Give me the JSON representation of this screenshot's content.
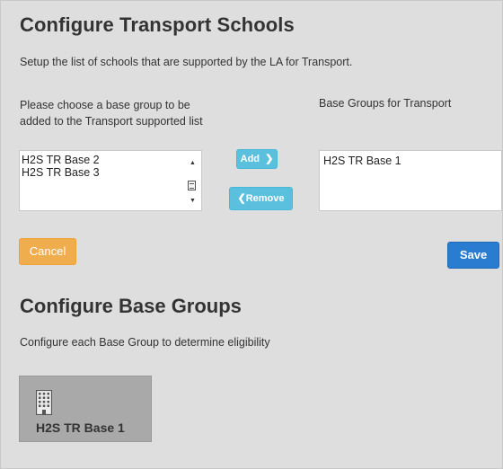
{
  "transport": {
    "title": "Configure Transport Schools",
    "description": "Setup the list of schools that are supported by the LA for Transport.",
    "choose_label": "Please choose a base group to be added to the Transport supported list",
    "available_items": [
      "H2S TR Base 2",
      "H2S TR Base 3"
    ],
    "selected_label": "Base Groups for Transport",
    "selected_items": [
      "H2S TR Base 1"
    ],
    "add_label": "Add",
    "add_icon": "chevron-right-icon",
    "remove_label": "Remove",
    "remove_icon": "chevron-left-icon",
    "cancel_label": "Cancel",
    "save_label": "Save"
  },
  "base_groups": {
    "title": "Configure Base Groups",
    "description": "Configure each Base Group to determine eligibility",
    "tiles": [
      {
        "label": "H2S TR Base 1",
        "icon": "building-icon"
      }
    ]
  },
  "colors": {
    "info_button": "#5bc0de",
    "warning_button": "#f0ad4e",
    "primary_button": "#2a7cd1",
    "panel_background": "#dedede",
    "tile_background": "#a9a9a9"
  }
}
